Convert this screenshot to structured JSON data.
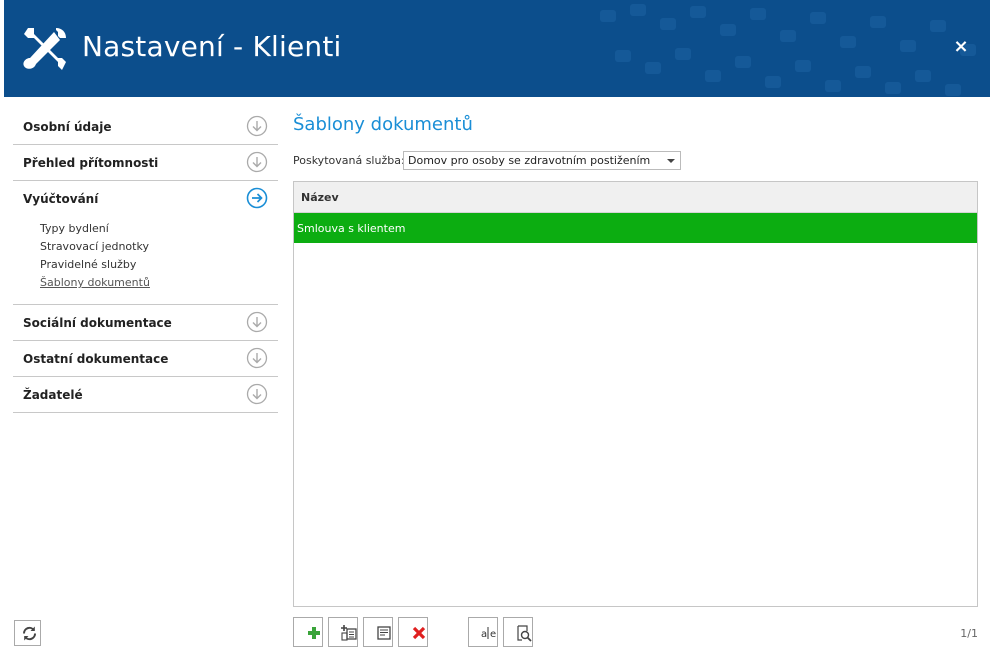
{
  "window": {
    "title": "Nastavení - Klienti",
    "close_glyph": "×",
    "accent_color": "#0c4e8c"
  },
  "sidebar": {
    "sections": [
      {
        "label": "Osobní údaje",
        "icon": "arrow-down-circle-icon",
        "expanded": false
      },
      {
        "label": "Přehled přítomnosti",
        "icon": "arrow-down-circle-icon",
        "expanded": false
      },
      {
        "label": "Vyúčtování",
        "icon": "arrow-right-circle-icon",
        "expanded": true,
        "items": [
          "Typy bydlení",
          "Stravovací jednotky",
          "Pravidelné služby",
          "Šablony dokumentů"
        ],
        "active_item": "Šablony dokumentů"
      },
      {
        "label": "Sociální dokumentace",
        "icon": "arrow-down-circle-icon",
        "expanded": false
      },
      {
        "label": "Ostatní dokumentace",
        "icon": "arrow-down-circle-icon",
        "expanded": false
      },
      {
        "label": "Žadatelé",
        "icon": "arrow-down-circle-icon",
        "expanded": false
      }
    ],
    "refresh_icon": "refresh-icon"
  },
  "main": {
    "heading": "Šablony dokumentů",
    "service_label": "Poskytovaná služba:",
    "service_value": "Domov pro osoby se zdravotním postižením",
    "grid": {
      "column_header": "Název",
      "rows": [
        {
          "name": "Smlouva s klientem",
          "selected": true
        }
      ],
      "selected_color": "#0cad11"
    },
    "toolbar": {
      "buttons": [
        "add-icon",
        "add-copy-icon",
        "edit-icon",
        "delete-icon",
        "text-replace-icon",
        "preview-icon"
      ]
    },
    "pager": "1/1"
  }
}
